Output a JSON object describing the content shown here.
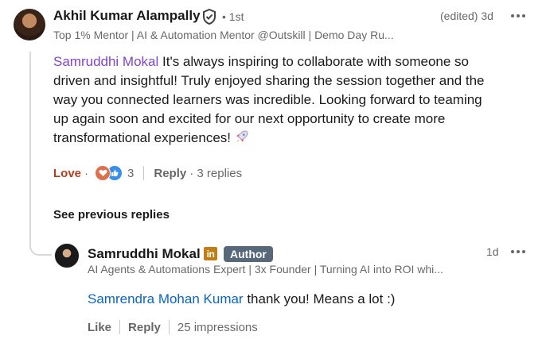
{
  "comment": {
    "author_name": "Akhil Kumar Alampally",
    "degree": "• 1st",
    "headline": "Top 1% Mentor | AI & Automation Mentor @Outskill | Demo Day Ru...",
    "edited_time": "(edited) 3d",
    "mention": "Samruddhi Mokal",
    "body": " It's always inspiring to collaborate with someone so driven and insightful! Truly enjoyed sharing the session together and the way you connected learners was incredible. Looking forward to teaming up again soon and excited for our next opportunity to create more transformational experiences!",
    "reaction_label": "Love",
    "separator": "·",
    "reaction_count": "3",
    "reply_label": "Reply",
    "replies_count": "· 3 replies",
    "icons": [
      "verified-shield-icon",
      "heart-reaction-icon",
      "like-reaction-icon",
      "rocket-emoji-icon",
      "more-options-icon"
    ]
  },
  "see_previous_label": "See previous replies",
  "reply": {
    "author_name": "Samruddhi Mokal",
    "linkedin_badge": "in",
    "author_badge": "Author",
    "time": "1d",
    "headline": "AI Agents & Automations Expert | 3x Founder | Turning AI into ROI whi...",
    "mention": "Samrendra Mohan Kumar",
    "body": " thank you! Means a lot :)",
    "like_label": "Like",
    "reply_label": "Reply",
    "impressions": "25 impressions"
  },
  "colors": {
    "love": "#b24020",
    "mention_purple": "#8344cc",
    "mention_blue": "#0a66c2",
    "author_badge_bg": "#56687a",
    "linkedin_premium": "#c37d16"
  }
}
